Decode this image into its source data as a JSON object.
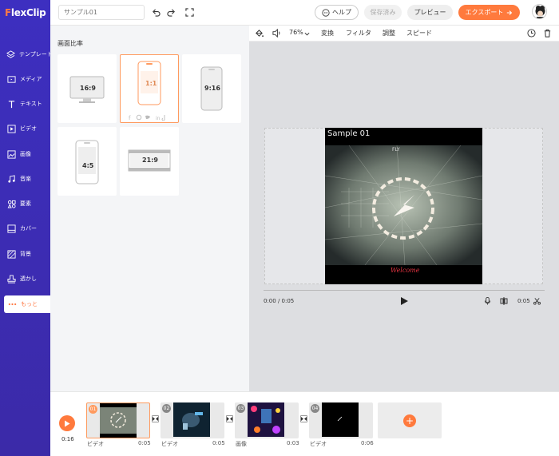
{
  "app": {
    "logo_f": "F",
    "logo_rest": "lexClip"
  },
  "sidebar": {
    "items": [
      {
        "label": "テンプレート",
        "icon": "layers-icon"
      },
      {
        "label": "メディア",
        "icon": "folder-icon"
      },
      {
        "label": "テキスト",
        "icon": "text-icon"
      },
      {
        "label": "ビデオ",
        "icon": "video-icon"
      },
      {
        "label": "画像",
        "icon": "image-icon"
      },
      {
        "label": "音楽",
        "icon": "music-icon"
      },
      {
        "label": "要素",
        "icon": "elements-icon"
      },
      {
        "label": "カバー",
        "icon": "cover-icon"
      },
      {
        "label": "背景",
        "icon": "background-icon"
      },
      {
        "label": "透かし",
        "icon": "watermark-icon"
      },
      {
        "label": "もっと",
        "icon": "more-icon"
      }
    ],
    "active_index": 10
  },
  "topbar": {
    "project_name_placeholder": "サンプル01",
    "help": "ヘルプ",
    "saved": "保存済み",
    "preview": "プレビュー",
    "export": "エクスポート"
  },
  "panel": {
    "title": "画面比率",
    "ratios": [
      "16:9",
      "1:1",
      "9:16",
      "4:5",
      "21:9"
    ],
    "selected": "1:1"
  },
  "editor": {
    "zoom": "76%",
    "tools": [
      "変換",
      "フィルタ",
      "調整",
      "スピード"
    ],
    "video_title": "Sample 01",
    "video_caption": "Welcome",
    "current_time": "0:00 / 0:05",
    "duration": "0:05"
  },
  "timeline": {
    "total": "0:16",
    "clips": [
      {
        "num": "01",
        "type": "ビデオ",
        "duration": "0:05"
      },
      {
        "num": "02",
        "type": "ビデオ",
        "duration": "0:05"
      },
      {
        "num": "03",
        "type": "画像",
        "duration": "0:03"
      },
      {
        "num": "04",
        "type": "ビデオ",
        "duration": "0:06"
      }
    ]
  }
}
